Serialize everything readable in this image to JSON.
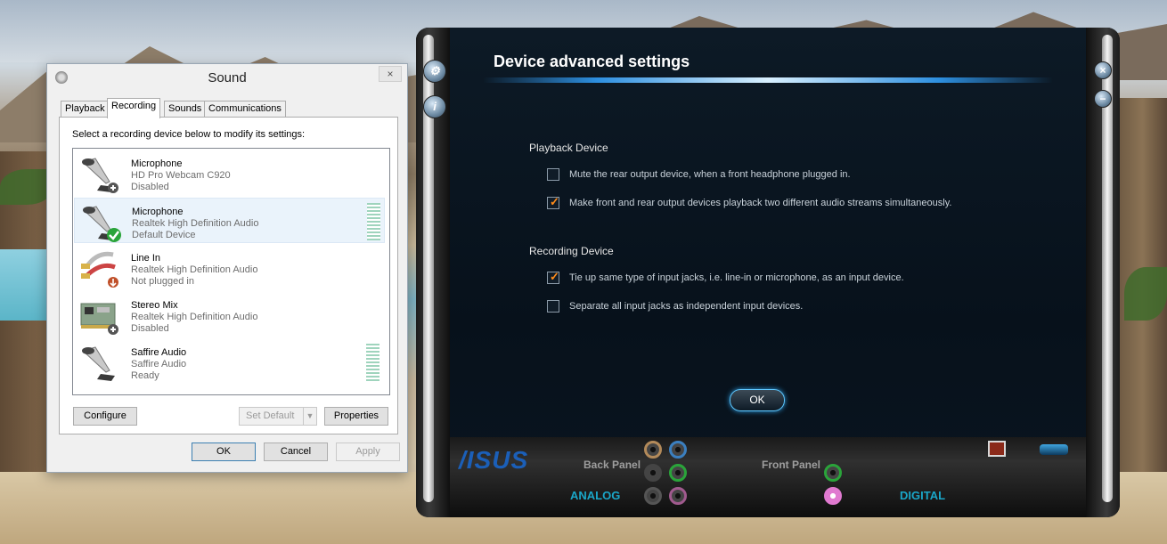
{
  "sound": {
    "title": "Sound",
    "close_icon": "×",
    "tabs": [
      "Playback",
      "Recording",
      "Sounds",
      "Communications"
    ],
    "active_tab": "Recording",
    "instruction": "Select a recording device below to modify its settings:",
    "devices": [
      {
        "name": "Microphone",
        "desc": "HD Pro Webcam C920",
        "status": "Disabled",
        "icon": "microphone-icon",
        "badge": "disabled-badge-icon"
      },
      {
        "name": "Microphone",
        "desc": "Realtek High Definition Audio",
        "status": "Default Device",
        "icon": "microphone-icon",
        "badge": "default-check-icon"
      },
      {
        "name": "Line In",
        "desc": "Realtek High Definition Audio",
        "status": "Not plugged in",
        "icon": "line-in-cable-icon",
        "badge": "unplugged-badge-icon"
      },
      {
        "name": "Stereo Mix",
        "desc": "Realtek High Definition Audio",
        "status": "Disabled",
        "icon": "sound-card-icon",
        "badge": "disabled-badge-icon"
      },
      {
        "name": "Saffire Audio",
        "desc": "Saffire Audio",
        "status": "Ready",
        "icon": "microphone-icon",
        "badge": ""
      }
    ],
    "buttons": {
      "configure": "Configure",
      "set_default": "Set Default",
      "properties": "Properties",
      "ok": "OK",
      "cancel": "Cancel",
      "apply": "Apply"
    }
  },
  "asus": {
    "title": "Device advanced settings",
    "playback_heading": "Playback Device",
    "playback_options": [
      {
        "label": "Mute the rear output device, when a front headphone plugged in.",
        "checked": false
      },
      {
        "label": "Make front and rear output devices playback two different audio streams simultaneously.",
        "checked": true
      }
    ],
    "recording_heading": "Recording Device",
    "recording_options": [
      {
        "label": "Tie up same type of input jacks, i.e. line-in or microphone, as an input device.",
        "checked": true
      },
      {
        "label": "Separate all input jacks as independent input devices.",
        "checked": false
      }
    ],
    "ok_label": "OK",
    "logo": "/ISUS",
    "back_panel_label": "Back Panel",
    "front_panel_label": "Front Panel",
    "analog_label": "ANALOG",
    "digital_label": "DIGITAL",
    "check_mark": "✓",
    "colors": {
      "accent": "#2d8fe0",
      "check": "#ff8c1a",
      "section_cyan": "#1aa6c8"
    }
  }
}
